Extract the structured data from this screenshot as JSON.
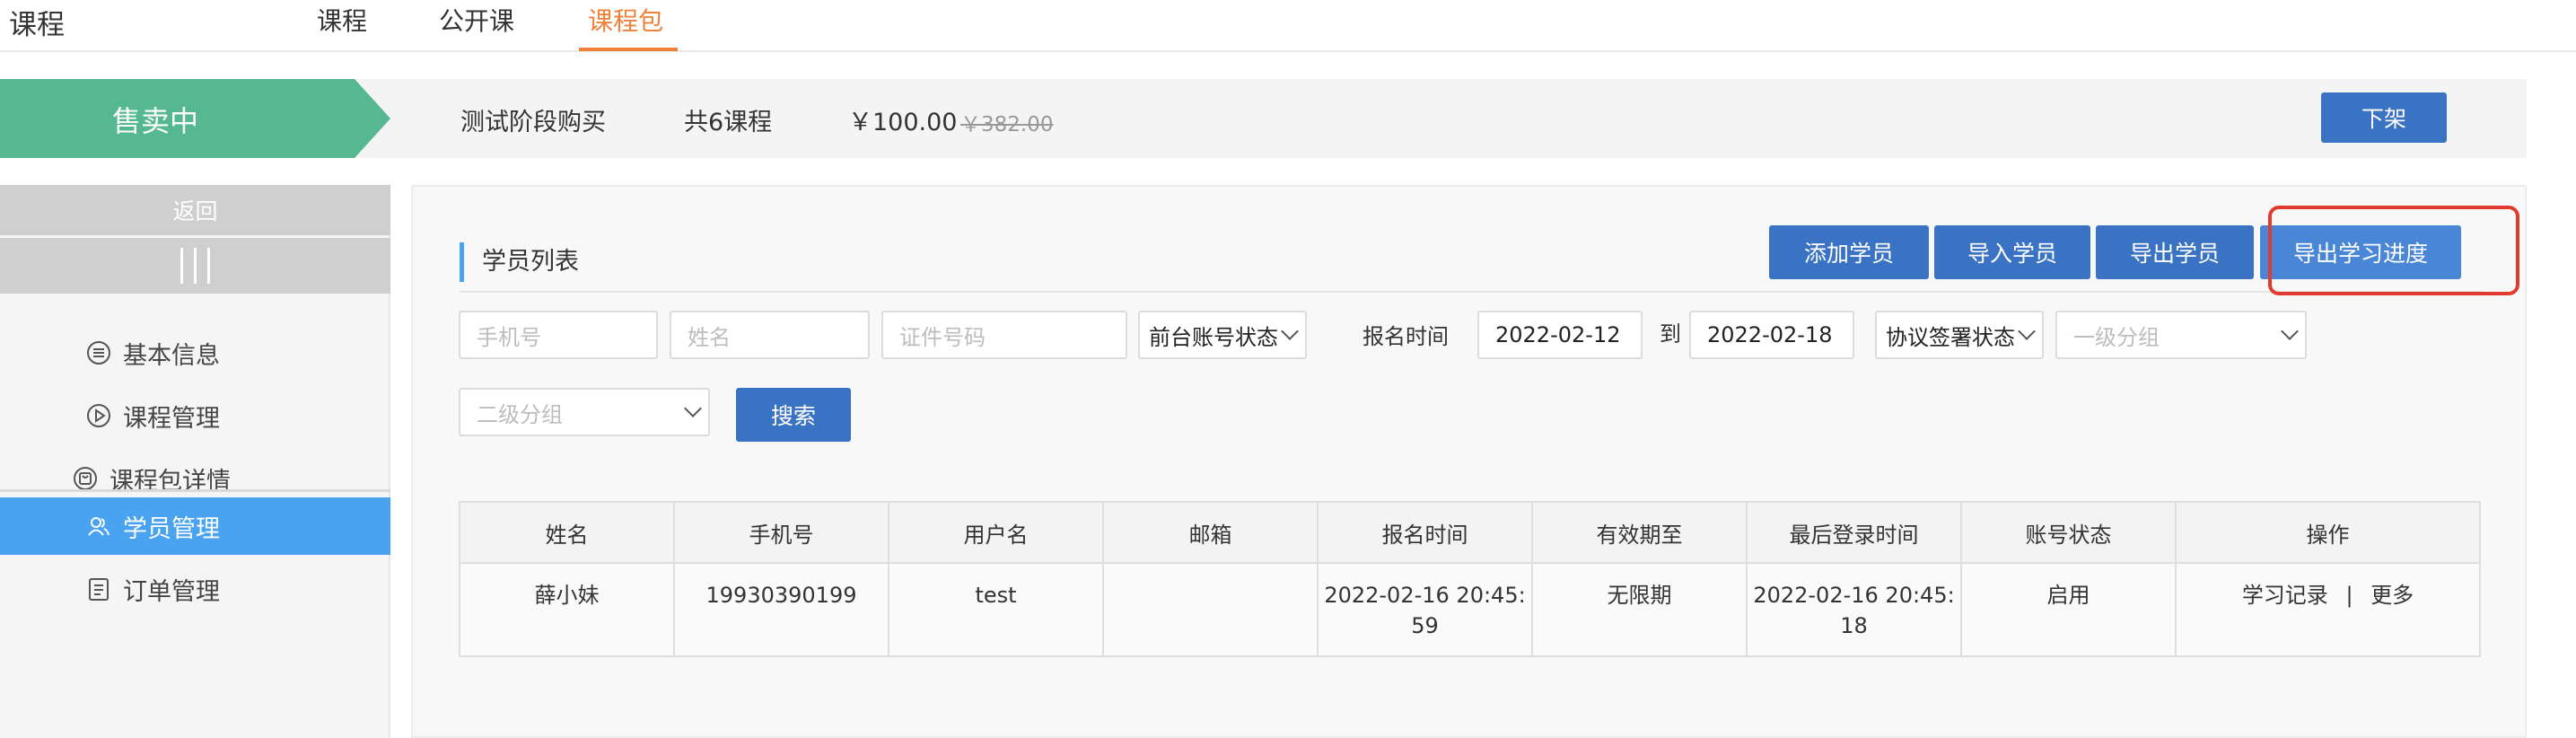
{
  "topnav": {
    "title": "课程",
    "tabs": [
      {
        "label": "课程"
      },
      {
        "label": "公开课"
      },
      {
        "label": "课程包"
      }
    ]
  },
  "status_bar": {
    "status": "售卖中",
    "stage": "测试阶段购买",
    "course_count": "共6课程",
    "price": "￥100.00",
    "original_price": "￥382.00",
    "delist_button": "下架"
  },
  "sidebar": {
    "back": "返回",
    "items": [
      {
        "label": "基本信息",
        "icon": "list-circle-icon"
      },
      {
        "label": "课程管理",
        "icon": "play-circle-icon"
      },
      {
        "label": "课程包详情",
        "icon": "package-icon"
      },
      {
        "label": "学员管理",
        "icon": "users-icon"
      },
      {
        "label": "订单管理",
        "icon": "clipboard-icon"
      }
    ]
  },
  "main": {
    "section_title": "学员列表",
    "actions": {
      "add": "添加学员",
      "import": "导入学员",
      "export": "导出学员",
      "export_progress": "导出学习进度"
    },
    "filters": {
      "phone_placeholder": "手机号",
      "name_placeholder": "姓名",
      "id_placeholder": "证件号码",
      "account_status": "前台账号状态",
      "signup_time_label": "报名时间",
      "date_from": "2022-02-12",
      "to_label": "到",
      "date_to": "2022-02-18",
      "agreement_status": "协议签署状态",
      "group1_placeholder": "一级分组",
      "group2_placeholder": "二级分组",
      "search_button": "搜索"
    },
    "table": {
      "headers": [
        "姓名",
        "手机号",
        "用户名",
        "邮箱",
        "报名时间",
        "有效期至",
        "最后登录时间",
        "账号状态",
        "操作"
      ],
      "rows": [
        {
          "name": "薛小妹",
          "phone": "19930390199",
          "username": "test",
          "email": "",
          "signup_time_1": "2022-02-16 20:45:",
          "signup_time_2": "59",
          "valid_until": "无限期",
          "last_login_1": "2022-02-16 20:45:",
          "last_login_2": "18",
          "account_status": "启用",
          "op_records": "学习记录",
          "op_sep": "|",
          "op_more": "更多"
        }
      ]
    }
  },
  "colors": {
    "accent_orange": "#f0813a",
    "status_green": "#55b890",
    "button_blue": "#3a73c4",
    "sidebar_active": "#4aa3f0",
    "highlight_red": "#e23b2e"
  }
}
